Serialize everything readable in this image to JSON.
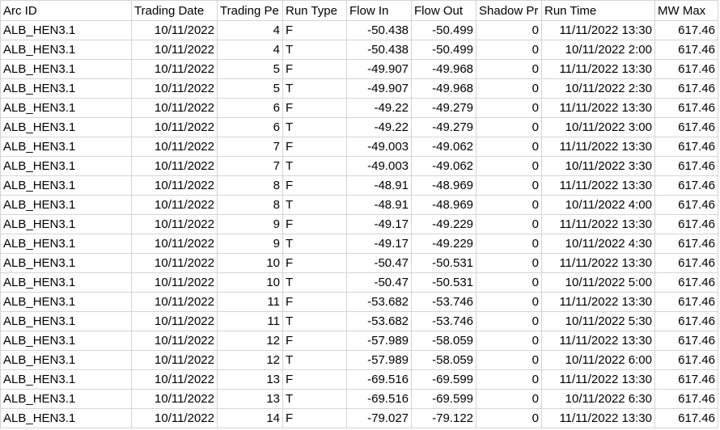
{
  "header": {
    "arc_id": "Arc ID",
    "trading_date": "Trading Date",
    "trading_period": "Trading Pe",
    "run_type": "Run Type",
    "flow_in": "Flow In",
    "flow_out": "Flow Out",
    "shadow_price": "Shadow Pr",
    "run_time": "Run Time",
    "mw_max": "MW Max"
  },
  "rows": [
    {
      "arc_id": "ALB_HEN3.1",
      "trading_date": "10/11/2022",
      "trading_period": "4",
      "run_type": "F",
      "flow_in": "-50.438",
      "flow_out": "-50.499",
      "shadow_price": "0",
      "run_time": "11/11/2022 13:30",
      "mw_max": "617.46"
    },
    {
      "arc_id": "ALB_HEN3.1",
      "trading_date": "10/11/2022",
      "trading_period": "4",
      "run_type": "T",
      "flow_in": "-50.438",
      "flow_out": "-50.499",
      "shadow_price": "0",
      "run_time": "10/11/2022 2:00",
      "mw_max": "617.46"
    },
    {
      "arc_id": "ALB_HEN3.1",
      "trading_date": "10/11/2022",
      "trading_period": "5",
      "run_type": "F",
      "flow_in": "-49.907",
      "flow_out": "-49.968",
      "shadow_price": "0",
      "run_time": "11/11/2022 13:30",
      "mw_max": "617.46"
    },
    {
      "arc_id": "ALB_HEN3.1",
      "trading_date": "10/11/2022",
      "trading_period": "5",
      "run_type": "T",
      "flow_in": "-49.907",
      "flow_out": "-49.968",
      "shadow_price": "0",
      "run_time": "10/11/2022 2:30",
      "mw_max": "617.46"
    },
    {
      "arc_id": "ALB_HEN3.1",
      "trading_date": "10/11/2022",
      "trading_period": "6",
      "run_type": "F",
      "flow_in": "-49.22",
      "flow_out": "-49.279",
      "shadow_price": "0",
      "run_time": "11/11/2022 13:30",
      "mw_max": "617.46"
    },
    {
      "arc_id": "ALB_HEN3.1",
      "trading_date": "10/11/2022",
      "trading_period": "6",
      "run_type": "T",
      "flow_in": "-49.22",
      "flow_out": "-49.279",
      "shadow_price": "0",
      "run_time": "10/11/2022 3:00",
      "mw_max": "617.46"
    },
    {
      "arc_id": "ALB_HEN3.1",
      "trading_date": "10/11/2022",
      "trading_period": "7",
      "run_type": "F",
      "flow_in": "-49.003",
      "flow_out": "-49.062",
      "shadow_price": "0",
      "run_time": "11/11/2022 13:30",
      "mw_max": "617.46"
    },
    {
      "arc_id": "ALB_HEN3.1",
      "trading_date": "10/11/2022",
      "trading_period": "7",
      "run_type": "T",
      "flow_in": "-49.003",
      "flow_out": "-49.062",
      "shadow_price": "0",
      "run_time": "10/11/2022 3:30",
      "mw_max": "617.46"
    },
    {
      "arc_id": "ALB_HEN3.1",
      "trading_date": "10/11/2022",
      "trading_period": "8",
      "run_type": "F",
      "flow_in": "-48.91",
      "flow_out": "-48.969",
      "shadow_price": "0",
      "run_time": "11/11/2022 13:30",
      "mw_max": "617.46"
    },
    {
      "arc_id": "ALB_HEN3.1",
      "trading_date": "10/11/2022",
      "trading_period": "8",
      "run_type": "T",
      "flow_in": "-48.91",
      "flow_out": "-48.969",
      "shadow_price": "0",
      "run_time": "10/11/2022 4:00",
      "mw_max": "617.46"
    },
    {
      "arc_id": "ALB_HEN3.1",
      "trading_date": "10/11/2022",
      "trading_period": "9",
      "run_type": "F",
      "flow_in": "-49.17",
      "flow_out": "-49.229",
      "shadow_price": "0",
      "run_time": "11/11/2022 13:30",
      "mw_max": "617.46"
    },
    {
      "arc_id": "ALB_HEN3.1",
      "trading_date": "10/11/2022",
      "trading_period": "9",
      "run_type": "T",
      "flow_in": "-49.17",
      "flow_out": "-49.229",
      "shadow_price": "0",
      "run_time": "10/11/2022 4:30",
      "mw_max": "617.46"
    },
    {
      "arc_id": "ALB_HEN3.1",
      "trading_date": "10/11/2022",
      "trading_period": "10",
      "run_type": "F",
      "flow_in": "-50.47",
      "flow_out": "-50.531",
      "shadow_price": "0",
      "run_time": "11/11/2022 13:30",
      "mw_max": "617.46"
    },
    {
      "arc_id": "ALB_HEN3.1",
      "trading_date": "10/11/2022",
      "trading_period": "10",
      "run_type": "T",
      "flow_in": "-50.47",
      "flow_out": "-50.531",
      "shadow_price": "0",
      "run_time": "10/11/2022 5:00",
      "mw_max": "617.46"
    },
    {
      "arc_id": "ALB_HEN3.1",
      "trading_date": "10/11/2022",
      "trading_period": "11",
      "run_type": "F",
      "flow_in": "-53.682",
      "flow_out": "-53.746",
      "shadow_price": "0",
      "run_time": "11/11/2022 13:30",
      "mw_max": "617.46"
    },
    {
      "arc_id": "ALB_HEN3.1",
      "trading_date": "10/11/2022",
      "trading_period": "11",
      "run_type": "T",
      "flow_in": "-53.682",
      "flow_out": "-53.746",
      "shadow_price": "0",
      "run_time": "10/11/2022 5:30",
      "mw_max": "617.46"
    },
    {
      "arc_id": "ALB_HEN3.1",
      "trading_date": "10/11/2022",
      "trading_period": "12",
      "run_type": "F",
      "flow_in": "-57.989",
      "flow_out": "-58.059",
      "shadow_price": "0",
      "run_time": "11/11/2022 13:30",
      "mw_max": "617.46"
    },
    {
      "arc_id": "ALB_HEN3.1",
      "trading_date": "10/11/2022",
      "trading_period": "12",
      "run_type": "T",
      "flow_in": "-57.989",
      "flow_out": "-58.059",
      "shadow_price": "0",
      "run_time": "10/11/2022 6:00",
      "mw_max": "617.46"
    },
    {
      "arc_id": "ALB_HEN3.1",
      "trading_date": "10/11/2022",
      "trading_period": "13",
      "run_type": "F",
      "flow_in": "-69.516",
      "flow_out": "-69.599",
      "shadow_price": "0",
      "run_time": "11/11/2022 13:30",
      "mw_max": "617.46"
    },
    {
      "arc_id": "ALB_HEN3.1",
      "trading_date": "10/11/2022",
      "trading_period": "13",
      "run_type": "T",
      "flow_in": "-69.516",
      "flow_out": "-69.599",
      "shadow_price": "0",
      "run_time": "10/11/2022 6:30",
      "mw_max": "617.46"
    },
    {
      "arc_id": "ALB_HEN3.1",
      "trading_date": "10/11/2022",
      "trading_period": "14",
      "run_type": "F",
      "flow_in": "-79.027",
      "flow_out": "-79.122",
      "shadow_price": "0",
      "run_time": "11/11/2022 13:30",
      "mw_max": "617.46"
    }
  ]
}
